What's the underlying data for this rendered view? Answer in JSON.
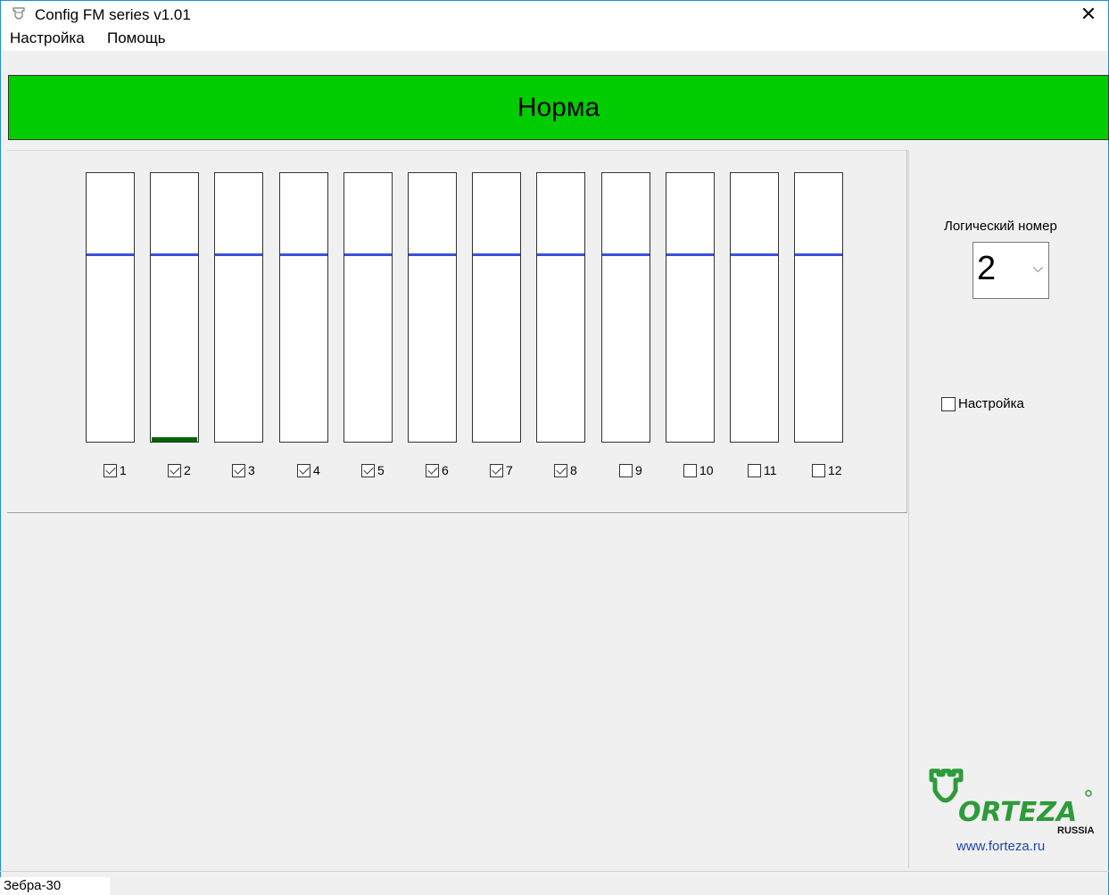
{
  "window": {
    "title": "Config FM series v1.01"
  },
  "menu": {
    "items": [
      "Настройка",
      "Помощь"
    ]
  },
  "status_banner": {
    "text": "Норма",
    "color": "#00cc00"
  },
  "channels": [
    {
      "label": "1",
      "checked": true,
      "level": 0.0
    },
    {
      "label": "2",
      "checked": true,
      "level": 0.015
    },
    {
      "label": "3",
      "checked": true,
      "level": 0.0
    },
    {
      "label": "4",
      "checked": true,
      "level": 0.0
    },
    {
      "label": "5",
      "checked": true,
      "level": 0.0
    },
    {
      "label": "6",
      "checked": true,
      "level": 0.0
    },
    {
      "label": "7",
      "checked": true,
      "level": 0.0
    },
    {
      "label": "8",
      "checked": true,
      "level": 0.0
    },
    {
      "label": "9",
      "checked": false,
      "level": 0.0
    },
    {
      "label": "10",
      "checked": false,
      "level": 0.0
    },
    {
      "label": "11",
      "checked": false,
      "level": 0.0
    },
    {
      "label": "12",
      "checked": false,
      "level": 0.0
    }
  ],
  "threshold_level": 0.7,
  "right_panel": {
    "logical_number_label": "Логический номер",
    "logical_number_value": "2",
    "settings_checkbox_label": "Настройка",
    "settings_checked": false
  },
  "logo": {
    "brand": "FORTEZA",
    "sub": "RUSSIA",
    "url": "www.forteza.ru",
    "color": "#2e9b3a"
  },
  "statusbar": {
    "text": "Зебра-30"
  }
}
